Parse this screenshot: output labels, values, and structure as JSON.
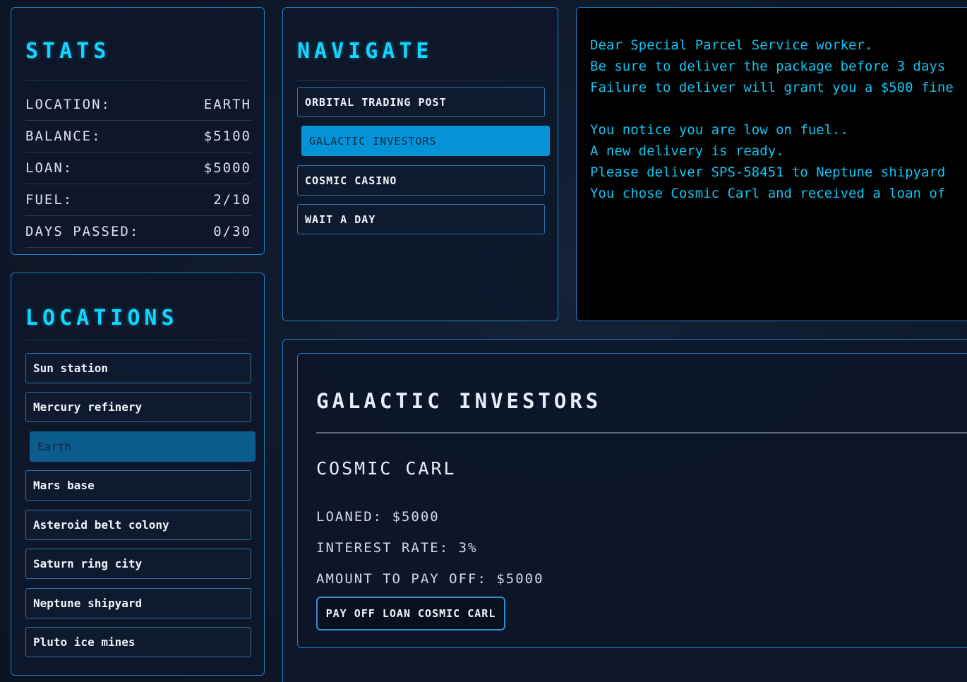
{
  "stats": {
    "title": "STATS",
    "rows": [
      {
        "label": "LOCATION:",
        "value": "EARTH"
      },
      {
        "label": "BALANCE:",
        "value": "$5100"
      },
      {
        "label": "LOAN:",
        "value": "$5000"
      },
      {
        "label": "FUEL:",
        "value": "2/10"
      },
      {
        "label": "DAYS PASSED:",
        "value": "0/30"
      }
    ]
  },
  "locations": {
    "title": "LOCATIONS",
    "items": [
      {
        "label": "Sun station"
      },
      {
        "label": "Mercury refinery"
      },
      {
        "label": "Earth",
        "active": true
      },
      {
        "label": "Mars base"
      },
      {
        "label": "Asteroid belt colony"
      },
      {
        "label": "Saturn ring city"
      },
      {
        "label": "Neptune shipyard"
      },
      {
        "label": "Pluto ice mines"
      }
    ]
  },
  "navigate": {
    "title": "NAVIGATE",
    "items": [
      {
        "label": "ORBITAL TRADING POST"
      },
      {
        "label": "GALACTIC INVESTORS",
        "active": true
      },
      {
        "label": "COSMIC CASINO"
      },
      {
        "label": "WAIT A DAY"
      }
    ]
  },
  "log": {
    "lines": [
      "Dear Special Parcel Service worker.",
      "Be sure to deliver the package before 3 days",
      "Failure to deliver will grant you a $500 fine",
      "",
      "You notice you are low on fuel..",
      "A new delivery is ready.",
      "Please deliver SPS-58451 to Neptune shipyard",
      "You chose Cosmic Carl and received a loan of"
    ]
  },
  "detail": {
    "title": "GALACTIC INVESTORS",
    "investor": "COSMIC CARL",
    "loaned": "LOANED: $5000",
    "interest": "INTEREST RATE: 3%",
    "payoff_amount": "AMOUNT TO PAY OFF: $5000",
    "payoff_button": "PAY OFF LOAN COSMIC CARL"
  }
}
